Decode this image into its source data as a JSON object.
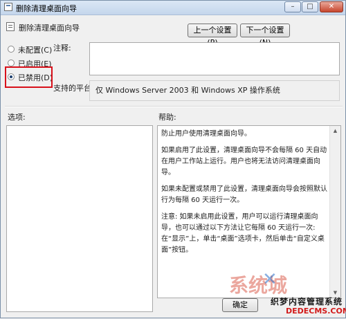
{
  "window": {
    "title": "删除清理桌面向导",
    "controls": {
      "minimize": "–",
      "maximize": "□",
      "close": "✕"
    }
  },
  "setting": {
    "name": "删除清理桌面向导",
    "prev_button": "上一个设置(P)",
    "next_button": "下一个设置(N)"
  },
  "state": {
    "options": [
      {
        "label": "未配置(C)",
        "selected": false
      },
      {
        "label": "已启用(E)",
        "selected": false
      },
      {
        "label": "已禁用(D)",
        "selected": true
      }
    ]
  },
  "comment": {
    "label": "注释:",
    "value": ""
  },
  "platform": {
    "label": "支持的平台:",
    "value": "仅 Windows Server 2003 和 Windows XP 操作系统"
  },
  "sections": {
    "options_label": "选项:",
    "help_label": "帮助:"
  },
  "help": {
    "paragraphs": [
      "防止用户使用清理桌面向导。",
      "如果启用了此设置，清理桌面向导不会每隔 60 天自动在用户工作站上运行。用户也将无法访问清理桌面向导。",
      "如果未配置或禁用了此设置，清理桌面向导会按照默认行为每隔 60 天运行一次。",
      "注意: 如果未启用此设置，用户可以运行清理桌面向导，也可以通过以下方法让它每隔 60 天运行一次: 在“显示”上，单击“桌面”选项卡，然后单击“自定义桌面”按钮。"
    ]
  },
  "footer": {
    "ok_button": "确定"
  },
  "watermark": {
    "logo": "系统城",
    "text": "织梦内容管理系统",
    "domain": "DEDECMS.COM"
  },
  "colors": {
    "highlight": "#d8101a"
  }
}
